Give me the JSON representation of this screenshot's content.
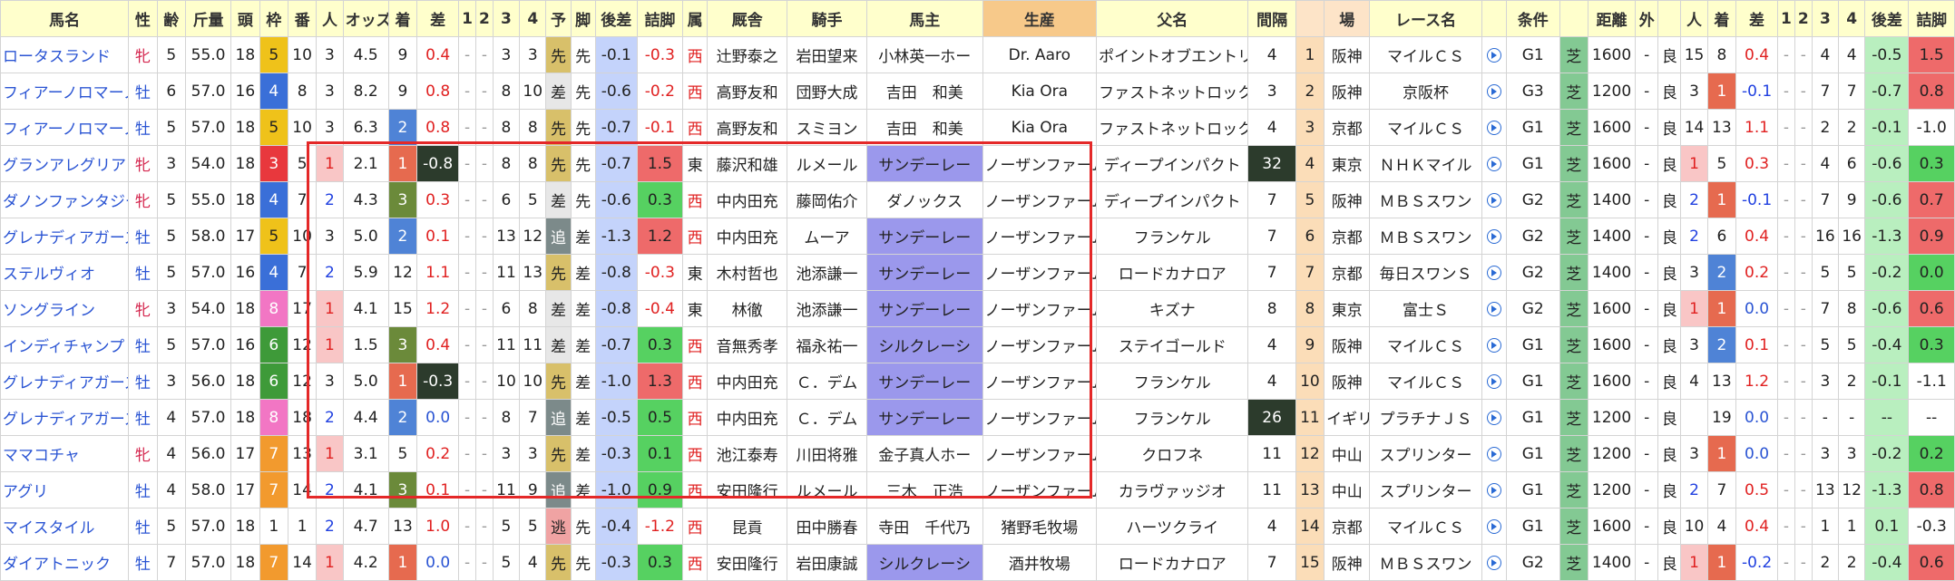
{
  "headers": [
    "馬名",
    "性",
    "齢",
    "斤量",
    "頭",
    "枠",
    "番",
    "人",
    "オッズ",
    "着",
    "差",
    "1",
    "2",
    "3",
    "4",
    "予",
    "脚",
    "後差",
    "詰脚",
    "属",
    "厩舎",
    "騎手",
    "馬主",
    "生産",
    "父名",
    "間隔",
    "",
    "場",
    "レース名",
    "",
    "条件",
    "",
    "距離",
    "外",
    "",
    "人",
    "着",
    "差",
    "1",
    "2",
    "3",
    "4",
    "後差",
    "詰脚"
  ],
  "rows": [
    {
      "name": "ロータスランド",
      "sex": "牝",
      "age": "5",
      "weight": "55.0",
      "heads": "18",
      "waku": "5",
      "ban": "10",
      "pop": "3",
      "odds": "4.5",
      "fin": "9",
      "diff": "0.4",
      "p1": "-",
      "p2": "-",
      "p3": "3",
      "p4": "3",
      "yo": "先",
      "kyaku": "先",
      "kosa": "-0.1",
      "tsume": "-0.3",
      "zoku": "西",
      "kyusha": "辻野泰之",
      "jockey": "岩田望来",
      "owner": "小林英一ホー",
      "breeder": "Dr. Aaro",
      "sire": "ポイントオブエントリー",
      "interval": "4",
      "idx": "1",
      "place": "阪神",
      "race": "マイルＣＳ",
      "grade": "G1",
      "surface": "芝",
      "dist": "1600",
      "out": "-",
      "going": "良",
      "pop2": "15",
      "fin2": "8",
      "diff2": "0.4",
      "q1": "-",
      "q2": "-",
      "q3": "4",
      "q4": "4",
      "kosa2": "-0.5",
      "tsume2": "1.5"
    },
    {
      "name": "フィアーノロマーノ",
      "sex": "牡",
      "age": "6",
      "weight": "57.0",
      "heads": "16",
      "waku": "4",
      "ban": "8",
      "pop": "3",
      "odds": "8.2",
      "fin": "9",
      "diff": "0.8",
      "p1": "-",
      "p2": "-",
      "p3": "8",
      "p4": "10",
      "yo": "差",
      "kyaku": "先",
      "kosa": "-0.6",
      "tsume": "-0.2",
      "zoku": "西",
      "kyusha": "高野友和",
      "jockey": "団野大成",
      "owner": "吉田　和美",
      "breeder": "Kia Ora",
      "sire": "ファストネットロック",
      "interval": "3",
      "idx": "2",
      "place": "阪神",
      "race": "京阪杯",
      "grade": "G3",
      "surface": "芝",
      "dist": "1200",
      "out": "-",
      "going": "良",
      "pop2": "3",
      "fin2": "1",
      "diff2": "-0.1",
      "q1": "-",
      "q2": "-",
      "q3": "7",
      "q4": "7",
      "kosa2": "-0.7",
      "tsume2": "0.8"
    },
    {
      "name": "フィアーノロマーノ",
      "sex": "牡",
      "age": "5",
      "weight": "57.0",
      "heads": "18",
      "waku": "5",
      "ban": "10",
      "pop": "3",
      "odds": "6.3",
      "fin": "2",
      "diff": "0.8",
      "p1": "-",
      "p2": "-",
      "p3": "8",
      "p4": "8",
      "yo": "先",
      "kyaku": "先",
      "kosa": "-0.7",
      "tsume": "-0.1",
      "zoku": "西",
      "kyusha": "高野友和",
      "jockey": "スミヨン",
      "owner": "吉田　和美",
      "breeder": "Kia Ora",
      "sire": "ファストネットロック",
      "interval": "4",
      "idx": "3",
      "place": "京都",
      "race": "マイルＣＳ",
      "grade": "G1",
      "surface": "芝",
      "dist": "1600",
      "out": "-",
      "going": "良",
      "pop2": "14",
      "fin2": "13",
      "diff2": "1.1",
      "q1": "-",
      "q2": "-",
      "q3": "2",
      "q4": "2",
      "kosa2": "-0.1",
      "tsume2": "-1.0"
    },
    {
      "name": "グランアレグリア",
      "sex": "牝",
      "age": "3",
      "weight": "54.0",
      "heads": "18",
      "waku": "3",
      "ban": "5",
      "pop": "1",
      "odds": "2.1",
      "fin": "1",
      "diff": "-0.8",
      "p1": "-",
      "p2": "-",
      "p3": "8",
      "p4": "8",
      "yo": "先",
      "kyaku": "先",
      "kosa": "-0.7",
      "tsume": "1.5",
      "zoku": "東",
      "kyusha": "藤沢和雄",
      "jockey": "ルメール",
      "owner": "サンデーレー",
      "breeder": "ノーザンファーム",
      "sire": "ディープインパクト",
      "interval": "32",
      "idx": "4",
      "place": "東京",
      "race": "ＮＨＫマイル",
      "grade": "G1",
      "surface": "芝",
      "dist": "1600",
      "out": "-",
      "going": "良",
      "pop2": "1",
      "fin2": "5",
      "diff2": "0.3",
      "q1": "-",
      "q2": "-",
      "q3": "4",
      "q4": "6",
      "kosa2": "-0.6",
      "tsume2": "0.3"
    },
    {
      "name": "ダノンファンタジー",
      "sex": "牝",
      "age": "5",
      "weight": "55.0",
      "heads": "18",
      "waku": "4",
      "ban": "7",
      "pop": "2",
      "odds": "4.3",
      "fin": "3",
      "diff": "0.3",
      "p1": "-",
      "p2": "-",
      "p3": "6",
      "p4": "5",
      "yo": "差",
      "kyaku": "先",
      "kosa": "-0.6",
      "tsume": "0.3",
      "zoku": "西",
      "kyusha": "中内田充",
      "jockey": "藤岡佑介",
      "owner": "ダノックス",
      "breeder": "ノーザンファーム",
      "sire": "ディープインパクト",
      "interval": "7",
      "idx": "5",
      "place": "阪神",
      "race": "ＭＢＳスワン",
      "grade": "G2",
      "surface": "芝",
      "dist": "1400",
      "out": "-",
      "going": "良",
      "pop2": "2",
      "fin2": "1",
      "diff2": "-0.1",
      "q1": "-",
      "q2": "-",
      "q3": "7",
      "q4": "9",
      "kosa2": "-0.6",
      "tsume2": "0.7"
    },
    {
      "name": "グレナディアガーズ",
      "sex": "牡",
      "age": "5",
      "weight": "58.0",
      "heads": "17",
      "waku": "5",
      "ban": "10",
      "pop": "3",
      "odds": "5.0",
      "fin": "2",
      "diff": "0.1",
      "p1": "-",
      "p2": "-",
      "p3": "13",
      "p4": "12",
      "yo": "追",
      "kyaku": "差",
      "kosa": "-1.3",
      "tsume": "1.2",
      "zoku": "西",
      "kyusha": "中内田充",
      "jockey": "ムーア",
      "owner": "サンデーレー",
      "breeder": "ノーザンファーム",
      "sire": "フランケル",
      "interval": "7",
      "idx": "6",
      "place": "京都",
      "race": "ＭＢＳスワン",
      "grade": "G2",
      "surface": "芝",
      "dist": "1400",
      "out": "-",
      "going": "良",
      "pop2": "2",
      "fin2": "6",
      "diff2": "0.4",
      "q1": "-",
      "q2": "-",
      "q3": "16",
      "q4": "16",
      "kosa2": "-1.3",
      "tsume2": "0.9"
    },
    {
      "name": "ステルヴィオ",
      "sex": "牡",
      "age": "5",
      "weight": "57.0",
      "heads": "16",
      "waku": "4",
      "ban": "7",
      "pop": "2",
      "odds": "5.9",
      "fin": "12",
      "diff": "1.1",
      "p1": "-",
      "p2": "-",
      "p3": "11",
      "p4": "13",
      "yo": "先",
      "kyaku": "差",
      "kosa": "-0.8",
      "tsume": "-0.3",
      "zoku": "東",
      "kyusha": "木村哲也",
      "jockey": "池添謙一",
      "owner": "サンデーレー",
      "breeder": "ノーザンファーム",
      "sire": "ロードカナロア",
      "interval": "7",
      "idx": "7",
      "place": "京都",
      "race": "毎日スワンＳ",
      "grade": "G2",
      "surface": "芝",
      "dist": "1400",
      "out": "-",
      "going": "良",
      "pop2": "3",
      "fin2": "2",
      "diff2": "0.2",
      "q1": "-",
      "q2": "-",
      "q3": "5",
      "q4": "5",
      "kosa2": "-0.2",
      "tsume2": "0.0"
    },
    {
      "name": "ソングライン",
      "sex": "牝",
      "age": "3",
      "weight": "54.0",
      "heads": "18",
      "waku": "8",
      "ban": "17",
      "pop": "1",
      "odds": "4.1",
      "fin": "15",
      "diff": "1.2",
      "p1": "-",
      "p2": "-",
      "p3": "6",
      "p4": "8",
      "yo": "差",
      "kyaku": "差",
      "kosa": "-0.8",
      "tsume": "-0.4",
      "zoku": "東",
      "kyusha": "林徹",
      "jockey": "池添謙一",
      "owner": "サンデーレー",
      "breeder": "ノーザンファーム",
      "sire": "キズナ",
      "interval": "8",
      "idx": "8",
      "place": "東京",
      "race": "富士Ｓ",
      "grade": "G2",
      "surface": "芝",
      "dist": "1600",
      "out": "-",
      "going": "良",
      "pop2": "1",
      "fin2": "1",
      "diff2": "0.0",
      "q1": "-",
      "q2": "-",
      "q3": "7",
      "q4": "8",
      "kosa2": "-0.6",
      "tsume2": "0.6"
    },
    {
      "name": "インディチャンプ",
      "sex": "牡",
      "age": "5",
      "weight": "57.0",
      "heads": "16",
      "waku": "6",
      "ban": "12",
      "pop": "1",
      "odds": "1.5",
      "fin": "3",
      "diff": "0.4",
      "p1": "-",
      "p2": "-",
      "p3": "11",
      "p4": "11",
      "yo": "差",
      "kyaku": "差",
      "kosa": "-0.7",
      "tsume": "0.3",
      "zoku": "西",
      "kyusha": "音無秀孝",
      "jockey": "福永祐一",
      "owner": "シルクレーシ",
      "breeder": "ノーザンファーム",
      "sire": "ステイゴールド",
      "interval": "4",
      "idx": "9",
      "place": "阪神",
      "race": "マイルＣＳ",
      "grade": "G1",
      "surface": "芝",
      "dist": "1600",
      "out": "-",
      "going": "良",
      "pop2": "3",
      "fin2": "2",
      "diff2": "0.1",
      "q1": "-",
      "q2": "-",
      "q3": "5",
      "q4": "5",
      "kosa2": "-0.4",
      "tsume2": "0.3"
    },
    {
      "name": "グレナディアガーズ",
      "sex": "牡",
      "age": "3",
      "weight": "56.0",
      "heads": "18",
      "waku": "6",
      "ban": "12",
      "pop": "3",
      "odds": "5.0",
      "fin": "1",
      "diff": "-0.3",
      "p1": "-",
      "p2": "-",
      "p3": "10",
      "p4": "10",
      "yo": "先",
      "kyaku": "差",
      "kosa": "-1.0",
      "tsume": "1.3",
      "zoku": "西",
      "kyusha": "中内田充",
      "jockey": "Ｃ．デム",
      "owner": "サンデーレー",
      "breeder": "ノーザンファーム",
      "sire": "フランケル",
      "interval": "4",
      "idx": "10",
      "place": "阪神",
      "race": "マイルＣＳ",
      "grade": "G1",
      "surface": "芝",
      "dist": "1600",
      "out": "-",
      "going": "良",
      "pop2": "4",
      "fin2": "13",
      "diff2": "1.2",
      "q1": "-",
      "q2": "-",
      "q3": "3",
      "q4": "2",
      "kosa2": "-0.1",
      "tsume2": "-1.1"
    },
    {
      "name": "グレナディアガーズ",
      "sex": "牡",
      "age": "4",
      "weight": "57.0",
      "heads": "18",
      "waku": "8",
      "ban": "18",
      "pop": "2",
      "odds": "4.4",
      "fin": "2",
      "diff": "0.0",
      "p1": "-",
      "p2": "-",
      "p3": "8",
      "p4": "7",
      "yo": "追",
      "kyaku": "差",
      "kosa": "-0.5",
      "tsume": "0.5",
      "zoku": "西",
      "kyusha": "中内田充",
      "jockey": "Ｃ．デム",
      "owner": "サンデーレー",
      "breeder": "ノーザンファーム",
      "sire": "フランケル",
      "interval": "26",
      "idx": "11",
      "place": "イギリス",
      "race": "プラチナＪＳ",
      "grade": "G1",
      "surface": "芝",
      "dist": "1200",
      "out": "-",
      "going": "良",
      "pop2": "",
      "fin2": "19",
      "diff2": "0.0",
      "q1": "-",
      "q2": "-",
      "q3": "-",
      "q4": "-",
      "kosa2": "--",
      "tsume2": "--"
    },
    {
      "name": "ママコチャ",
      "sex": "牝",
      "age": "4",
      "weight": "56.0",
      "heads": "17",
      "waku": "7",
      "ban": "13",
      "pop": "1",
      "odds": "3.1",
      "fin": "5",
      "diff": "0.2",
      "p1": "-",
      "p2": "-",
      "p3": "3",
      "p4": "3",
      "yo": "先",
      "kyaku": "差",
      "kosa": "-0.3",
      "tsume": "0.1",
      "zoku": "西",
      "kyusha": "池江泰寿",
      "jockey": "川田将雅",
      "owner": "金子真人ホー",
      "breeder": "ノーザンファーム",
      "sire": "クロフネ",
      "interval": "11",
      "idx": "12",
      "place": "中山",
      "race": "スプリンター",
      "grade": "G1",
      "surface": "芝",
      "dist": "1200",
      "out": "-",
      "going": "良",
      "pop2": "3",
      "fin2": "1",
      "diff2": "0.0",
      "q1": "-",
      "q2": "-",
      "q3": "3",
      "q4": "3",
      "kosa2": "-0.2",
      "tsume2": "0.2"
    },
    {
      "name": "アグリ",
      "sex": "牡",
      "age": "4",
      "weight": "58.0",
      "heads": "17",
      "waku": "7",
      "ban": "14",
      "pop": "2",
      "odds": "4.1",
      "fin": "3",
      "diff": "0.1",
      "p1": "-",
      "p2": "-",
      "p3": "11",
      "p4": "9",
      "yo": "追",
      "kyaku": "差",
      "kosa": "-1.0",
      "tsume": "0.9",
      "zoku": "西",
      "kyusha": "安田隆行",
      "jockey": "ルメール",
      "owner": "三木　正浩",
      "breeder": "ノーザンファーム",
      "sire": "カラヴァッジオ",
      "interval": "11",
      "idx": "13",
      "place": "中山",
      "race": "スプリンター",
      "grade": "G1",
      "surface": "芝",
      "dist": "1200",
      "out": "-",
      "going": "良",
      "pop2": "2",
      "fin2": "7",
      "diff2": "0.5",
      "q1": "-",
      "q2": "-",
      "q3": "13",
      "q4": "12",
      "kosa2": "-1.3",
      "tsume2": "0.8"
    },
    {
      "name": "マイスタイル",
      "sex": "牡",
      "age": "5",
      "weight": "57.0",
      "heads": "18",
      "waku": "1",
      "ban": "1",
      "pop": "2",
      "odds": "4.7",
      "fin": "13",
      "diff": "1.0",
      "p1": "-",
      "p2": "-",
      "p3": "5",
      "p4": "5",
      "yo": "逃",
      "kyaku": "先",
      "kosa": "-0.4",
      "tsume": "-1.2",
      "zoku": "西",
      "kyusha": "昆貢",
      "jockey": "田中勝春",
      "owner": "寺田　千代乃",
      "breeder": "猪野毛牧場",
      "sire": "ハーツクライ",
      "interval": "4",
      "idx": "14",
      "place": "京都",
      "race": "マイルＣＳ",
      "grade": "G1",
      "surface": "芝",
      "dist": "1600",
      "out": "-",
      "going": "良",
      "pop2": "10",
      "fin2": "4",
      "diff2": "0.4",
      "q1": "-",
      "q2": "-",
      "q3": "1",
      "q4": "1",
      "kosa2": "0.1",
      "tsume2": "-0.3"
    },
    {
      "name": "ダイアトニック",
      "sex": "牡",
      "age": "7",
      "weight": "57.0",
      "heads": "18",
      "waku": "7",
      "ban": "14",
      "pop": "1",
      "odds": "4.2",
      "fin": "1",
      "diff": "0.0",
      "p1": "-",
      "p2": "-",
      "p3": "5",
      "p4": "4",
      "yo": "先",
      "kyaku": "先",
      "kosa": "-0.3",
      "tsume": "0.3",
      "zoku": "西",
      "kyusha": "安田隆行",
      "jockey": "岩田康誠",
      "owner": "シルクレーシ",
      "breeder": "酒井牧場",
      "sire": "ロードカナロア",
      "interval": "7",
      "idx": "15",
      "place": "阪神",
      "race": "ＭＢＳスワン",
      "grade": "G2",
      "surface": "芝",
      "dist": "1400",
      "out": "-",
      "going": "良",
      "pop2": "1",
      "fin2": "1",
      "diff2": "-0.2",
      "q1": "-",
      "q2": "-",
      "q3": "2",
      "q4": "2",
      "kosa2": "-0.4",
      "tsume2": "0.6"
    }
  ]
}
